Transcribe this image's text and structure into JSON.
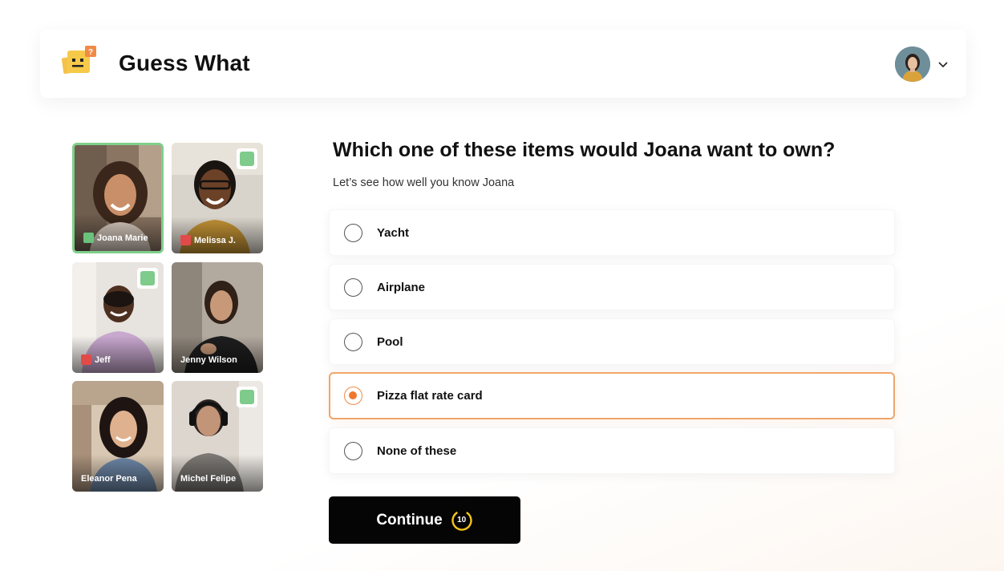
{
  "app": {
    "title": "Guess What"
  },
  "header": {
    "avatar_icon": "user-avatar",
    "menu_icon": "chevron-down-icon"
  },
  "participants": [
    {
      "name": "Joana Marie",
      "mic": "on",
      "answered": false,
      "active": true
    },
    {
      "name": "Melissa J.",
      "mic": "off",
      "answered": true,
      "active": false
    },
    {
      "name": "Jeff",
      "mic": "off",
      "answered": true,
      "active": false
    },
    {
      "name": "Jenny Wilson",
      "mic": null,
      "answered": false,
      "active": false
    },
    {
      "name": "Eleanor Pena",
      "mic": null,
      "answered": false,
      "active": false
    },
    {
      "name": "Michel Felipe",
      "mic": null,
      "answered": true,
      "active": false
    }
  ],
  "quiz": {
    "question": "Which one of these items would Joana want to own?",
    "subtitle": "Let’s see how well you know Joana",
    "options": [
      "Yacht",
      "Airplane",
      "Pool",
      "Pizza flat rate card",
      "None of these"
    ],
    "selected_index": 3,
    "continue_label": "Continue",
    "timer": "10"
  },
  "colors": {
    "accent": "#f0782d",
    "active_border": "#7fcf8b",
    "mic_on": "#6ac27b",
    "mic_off": "#e24a4a",
    "timer_ring": "#f5c518"
  }
}
